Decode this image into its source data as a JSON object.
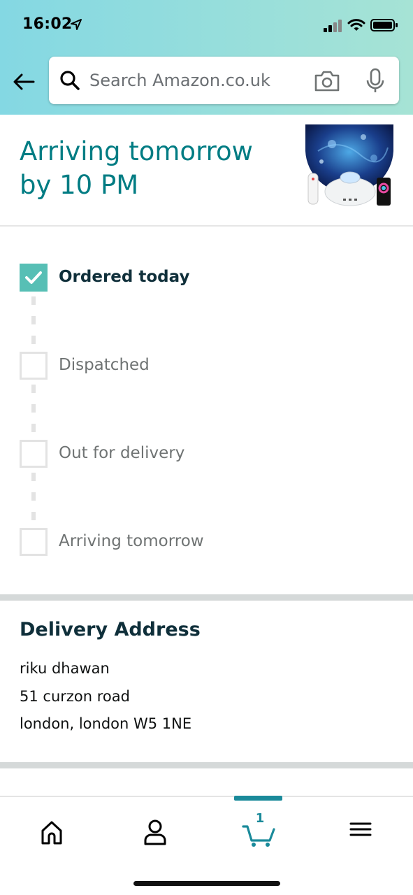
{
  "status_bar": {
    "time": "16:02"
  },
  "search": {
    "placeholder": "Search Amazon.co.uk"
  },
  "arrival": {
    "line1": "Arriving tomorrow",
    "line2": "by 10 PM"
  },
  "tracker": {
    "steps": [
      {
        "label": "Ordered today",
        "done": true
      },
      {
        "label": "Dispatched",
        "done": false
      },
      {
        "label": "Out for delivery",
        "done": false
      },
      {
        "label": "Arriving tomorrow",
        "done": false
      }
    ]
  },
  "address": {
    "heading": "Delivery Address",
    "name": "riku dhawan",
    "street": "51 curzon road",
    "city": "london, london W5 1NE"
  },
  "bottom_nav": {
    "items": [
      "home-icon",
      "account-icon",
      "cart-icon",
      "menu-icon"
    ],
    "cart_count": "1",
    "active": "cart"
  },
  "colors": {
    "accent_teal": "#007c83",
    "check_green": "#57bfb5",
    "nav_active": "#1a8a9a"
  }
}
